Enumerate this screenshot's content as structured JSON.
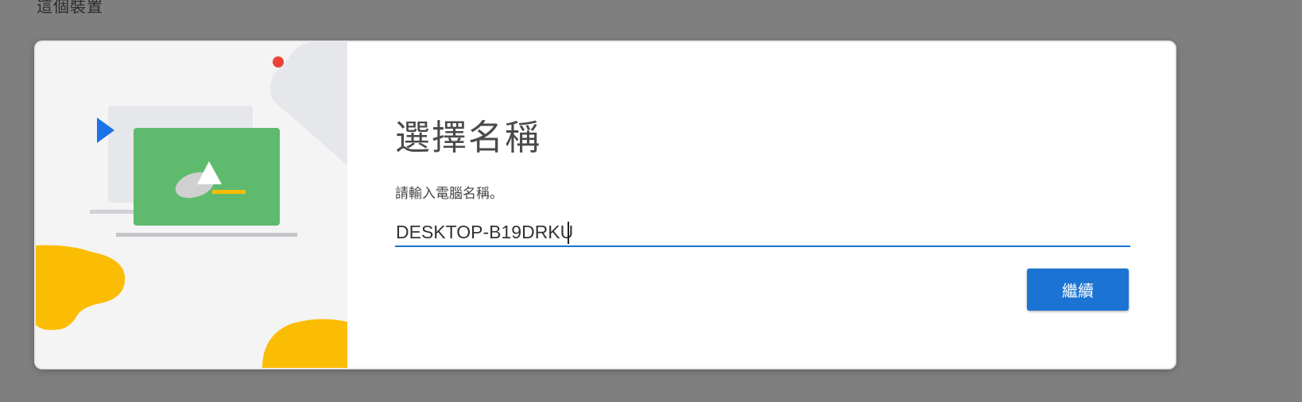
{
  "background": {
    "heading": "這個裝置"
  },
  "dialog": {
    "title": "選擇名稱",
    "subtitle": "請輸入電腦名稱。",
    "name_input": {
      "value": "DESKTOP-B19DRKU",
      "focused": true
    },
    "continue_label": "繼續"
  },
  "colors": {
    "overlay": "#7f7f7f",
    "accent": "#1a73d4",
    "illustration_green": "#5ebb6e",
    "illustration_yellow": "#fbbc04",
    "illustration_blue": "#1a73e8",
    "illustration_red": "#ea4335"
  },
  "icons": {
    "illustration": "laptop-setup-illustration"
  }
}
